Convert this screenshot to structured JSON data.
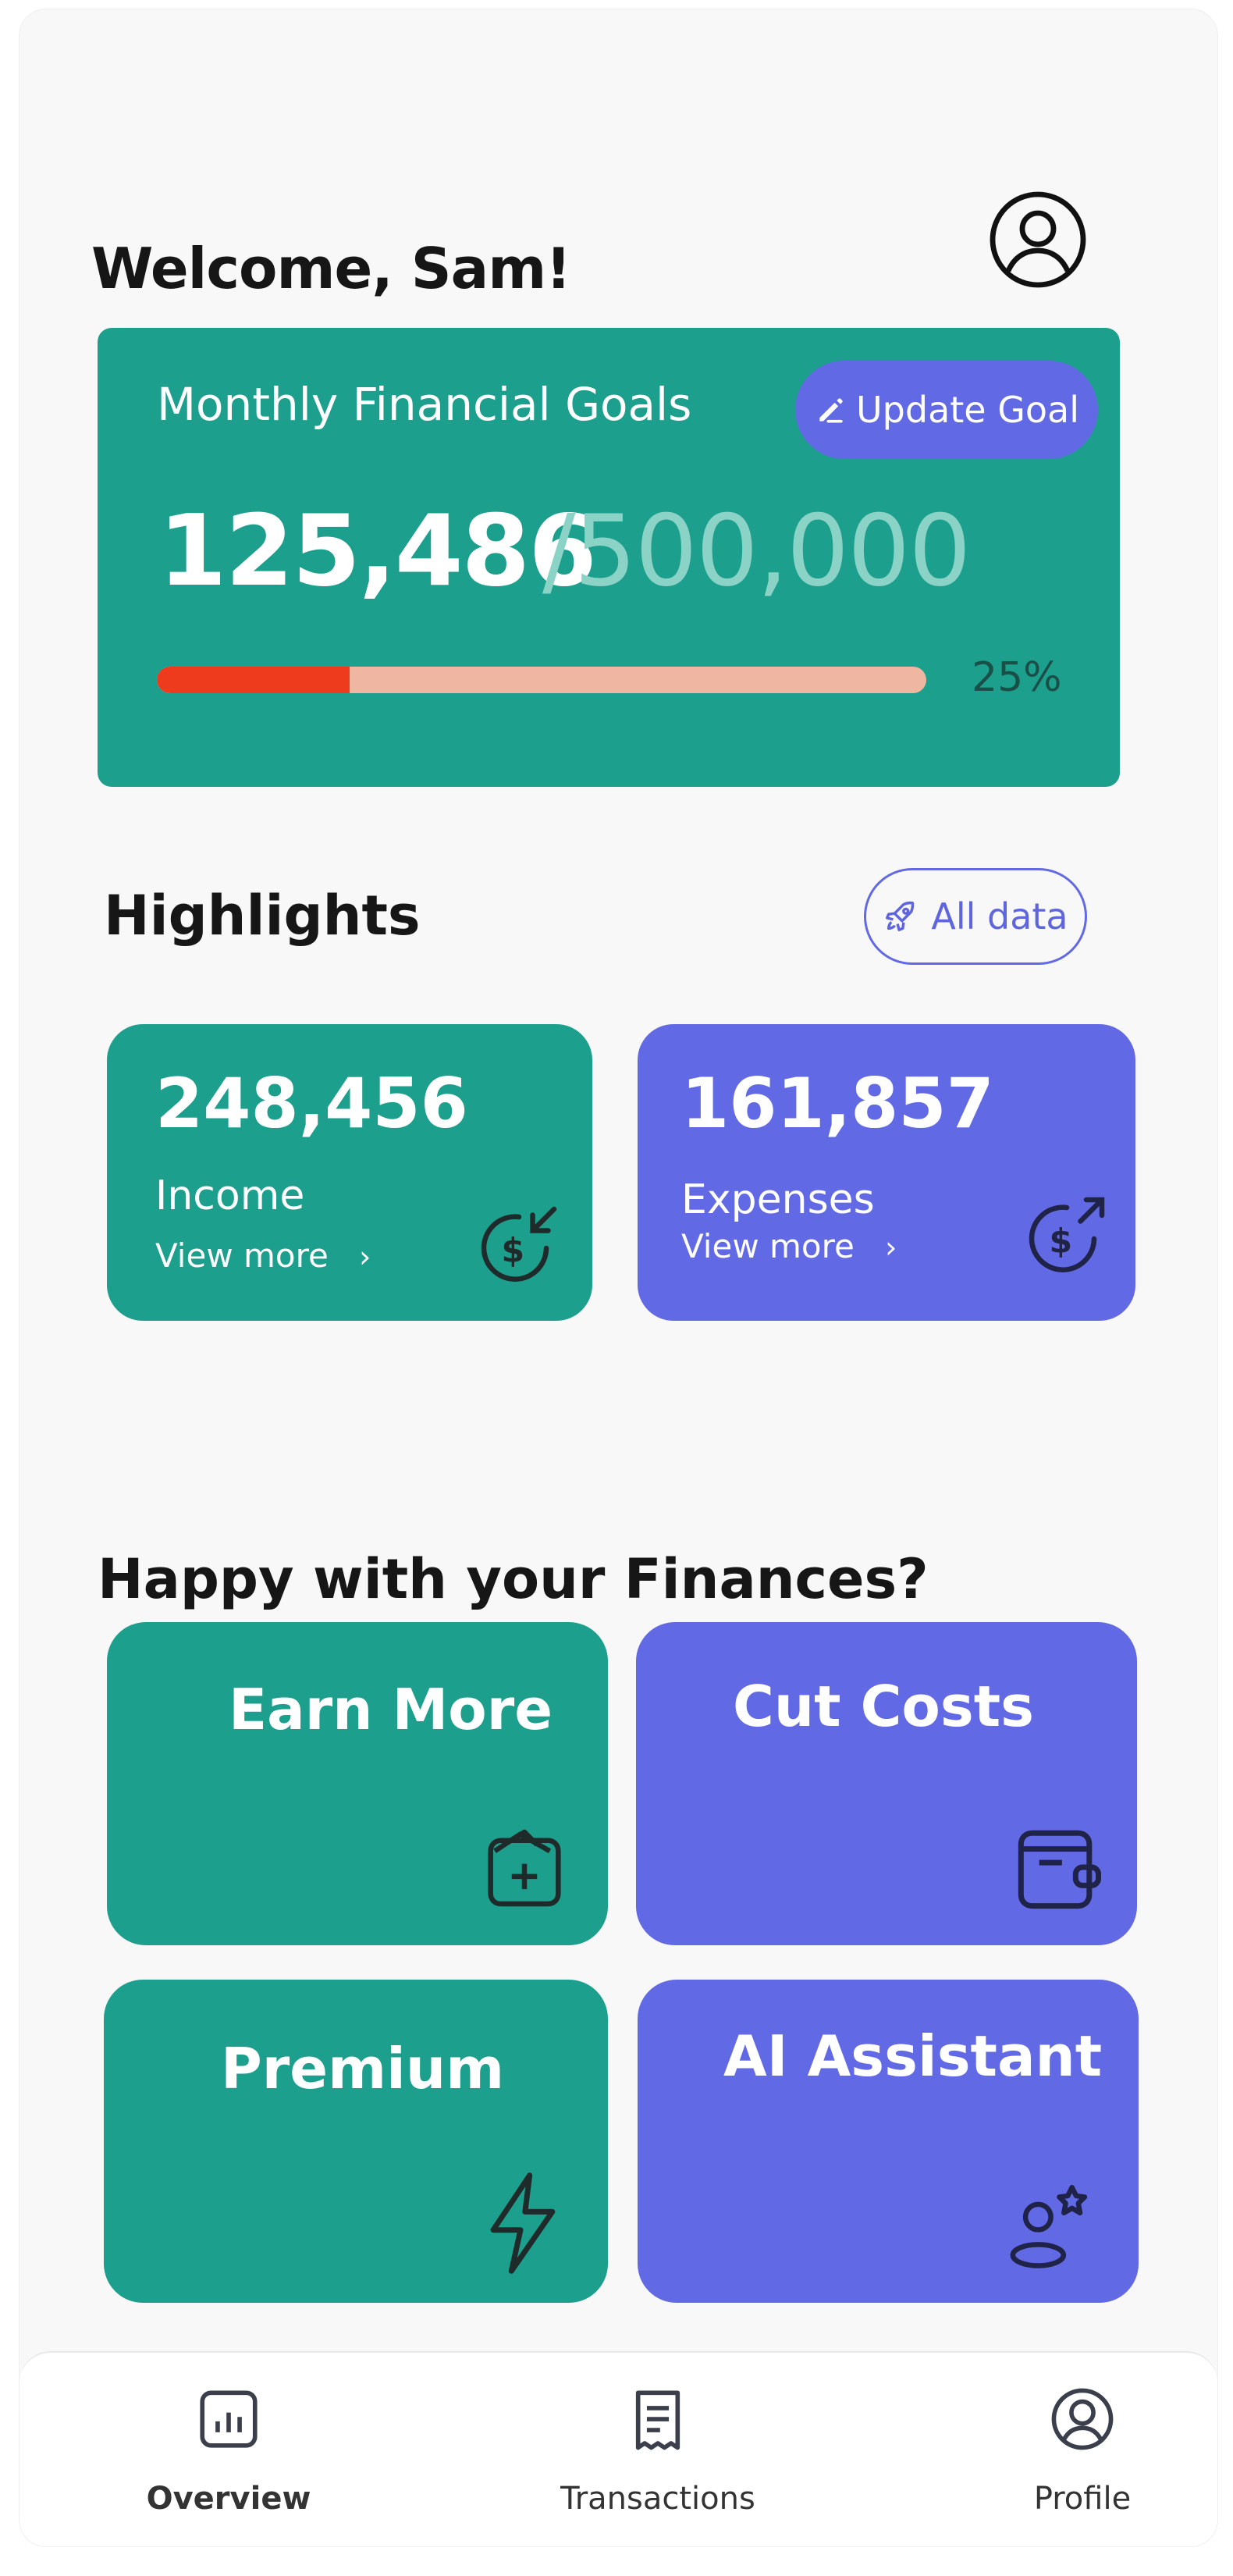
{
  "header": {
    "welcome": "Welcome, Sam!"
  },
  "goal": {
    "title": "Monthly Financial Goals",
    "update_label": "Update Goal",
    "current": "125,486",
    "target": "/500,000",
    "progress_percent": 25,
    "progress_label": "25%"
  },
  "highlights": {
    "title": "Highlights",
    "all_data_label": "All data",
    "income": {
      "value": "248,456",
      "label": "Income",
      "more": "View more"
    },
    "expenses": {
      "value": "161,857",
      "label": "Expenses",
      "more": "View more"
    }
  },
  "finances": {
    "title": "Happy with your Finances?",
    "cards": [
      {
        "label": "Earn More",
        "icon": "wallet-add-icon"
      },
      {
        "label": "Cut Costs",
        "icon": "wallet-icon"
      },
      {
        "label": "Premium",
        "icon": "lightning-icon"
      },
      {
        "label": "AI Assistant",
        "icon": "user-star-icon"
      }
    ]
  },
  "nav": [
    {
      "label": "Overview",
      "icon": "chart-icon"
    },
    {
      "label": "Transactions",
      "icon": "receipt-icon"
    },
    {
      "label": "Profile",
      "icon": "user-circle-icon"
    }
  ],
  "colors": {
    "teal": "#1d9f8d",
    "indigo": "#6269e4",
    "progress": "#ee3a1d"
  }
}
